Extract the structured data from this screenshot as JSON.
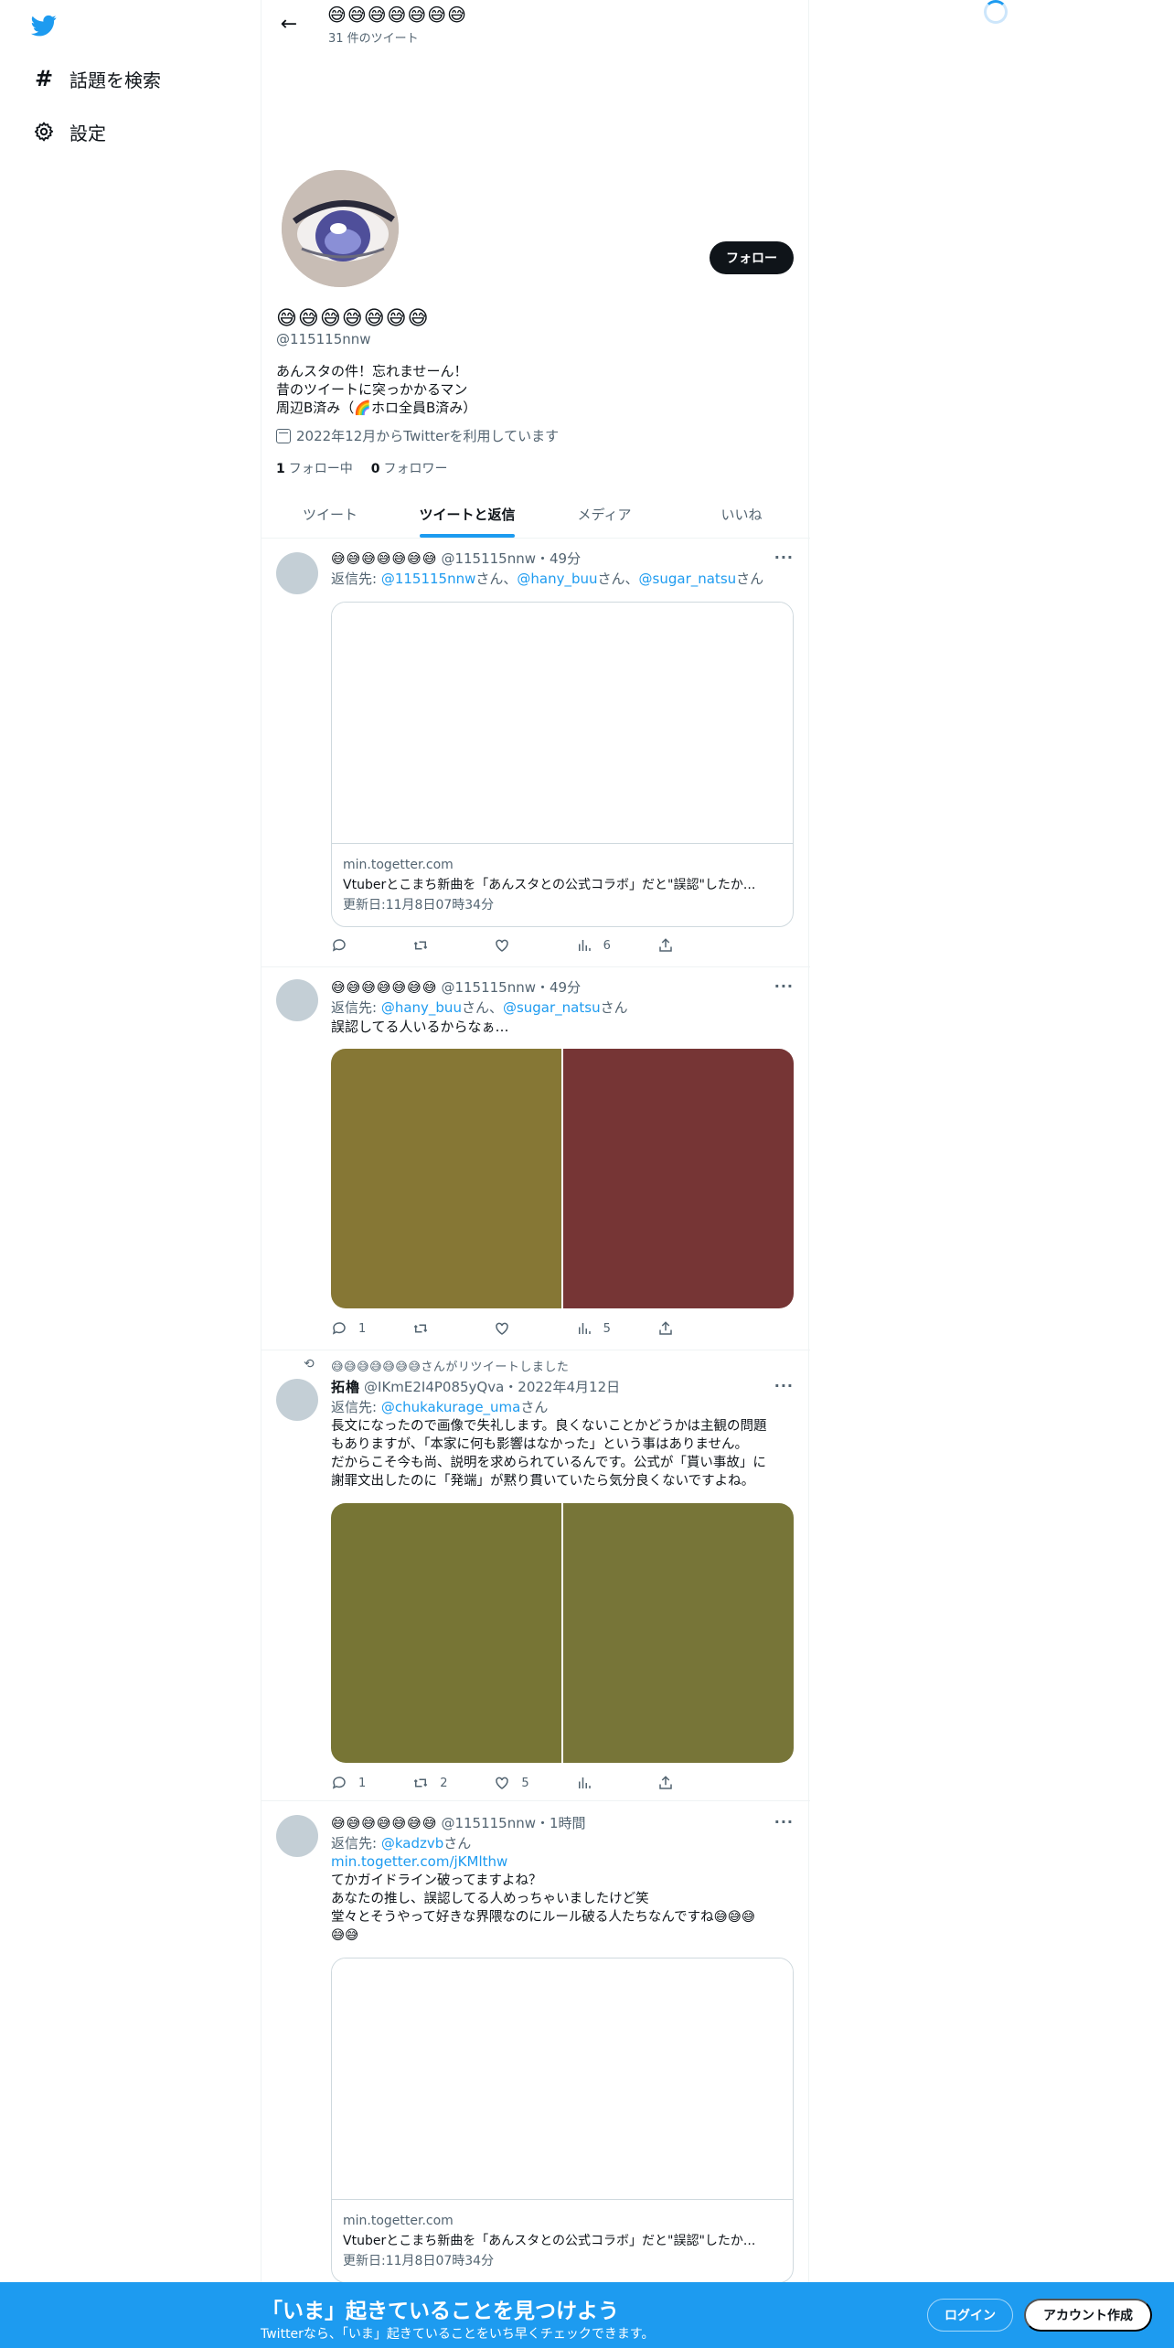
{
  "nav": {
    "items": [
      {
        "icon": "hashtag-icon",
        "label": "話題を検索"
      },
      {
        "icon": "gear-icon",
        "label": "設定"
      }
    ]
  },
  "header": {
    "name": "😅😅😅😅😅😅😅",
    "tweet_count": "31 件のツイート"
  },
  "profile": {
    "name": "😅😅😅😅😅😅😅",
    "handle": "@115115nnw",
    "follow_label": "フォロー",
    "bio": [
      "あんスタの件！忘れませーん！",
      "昔のツイートに突っかかるマン",
      "周辺B済み（🌈ホロ全員B済み）"
    ],
    "joined": "2022年12月からTwitterを利用しています",
    "following_count": "1",
    "following_label": "フォロー中",
    "followers_count": "0",
    "followers_label": "フォロワー"
  },
  "tabs": [
    {
      "label": "ツイート",
      "active": false
    },
    {
      "label": "ツイートと返信",
      "active": true
    },
    {
      "label": "メディア",
      "active": false
    },
    {
      "label": "いいね",
      "active": false
    }
  ],
  "tweets": [
    {
      "name": "😅😅😅😅😅😅😅",
      "handle_time": "@115115nnw・49分",
      "reply_prefix": "返信先: ",
      "reply_to": [
        {
          "handle": "@115115nnw",
          "suffix": "さん、"
        },
        {
          "handle": "@hany_buu",
          "suffix": "さん、"
        },
        {
          "handle": "@sugar_natsu",
          "suffix": "さん"
        }
      ],
      "card": {
        "domain": "min.togetter.com",
        "title": "Vtuberとこまち新曲を「あんスタとの公式コラボ」だと\"誤認\"したか...",
        "updated": "更新日:11月8日07時34分"
      },
      "stats": {
        "reply": "",
        "retweet": "",
        "like": "",
        "views": "6"
      }
    },
    {
      "name": "😅😅😅😅😅😅😅",
      "handle_time": "@115115nnw・49分",
      "reply_prefix": "返信先: ",
      "reply_to": [
        {
          "handle": "@hany_buu",
          "suffix": "さん、"
        },
        {
          "handle": "@sugar_natsu",
          "suffix": "さん"
        }
      ],
      "text": "誤認してる人いるからなぁ…",
      "media_colors": [
        "#867735",
        "#763535"
      ],
      "stats": {
        "reply": "1",
        "retweet": "",
        "like": "",
        "views": "5"
      }
    },
    {
      "retweeted_by": "😅😅😅😅😅😅😅さんがリツイートしました",
      "name": "拓櫓",
      "handle_time": "@IKmE2I4P085yQva・2022年4月12日",
      "reply_prefix": "返信先: ",
      "reply_to": [
        {
          "handle": "@chukakurage_uma",
          "suffix": "さん"
        }
      ],
      "text_lines": [
        "長文になったので画像で失礼します。良くないことかどうかは主観の問題",
        "もありますが、「本家に何も影響はなかった」という事はありません。",
        "だからこそ今も尚、説明を求められているんです。公式が「貰い事故」に",
        "謝罪文出したのに「発端」が黙り貫いていたら気分良くないですよね。"
      ],
      "media_colors": [
        "#777535",
        "#777538"
      ],
      "stats": {
        "reply": "1",
        "retweet": "2",
        "like": "5",
        "views": ""
      }
    },
    {
      "name": "😅😅😅😅😅😅😅",
      "handle_time": "@115115nnw・1時間",
      "reply_prefix": "返信先: ",
      "reply_to": [
        {
          "handle": "@kadzvb",
          "suffix": "さん"
        }
      ],
      "link": "min.togetter.com/jKMlthw",
      "text_lines": [
        "てかガイドライン破ってますよね？",
        "あなたの推し、誤認してる人めっちゃいましたけど笑",
        "堂々とそうやって好きな界隈なのにルール破る人たちなんですね😅😅😅",
        "😅😅"
      ],
      "card": {
        "domain": "min.togetter.com",
        "title": "Vtuberとこまち新曲を「あんスタとの公式コラボ」だと\"誤認\"したか...",
        "updated": "更新日:11月8日07時34分"
      }
    }
  ],
  "bottom_bar": {
    "title": "「いま」起きていることを見つけよう",
    "subtitle": "Twitterなら、「いま」起きていることをいち早くチェックできます。",
    "login": "ログイン",
    "signup": "アカウント作成"
  },
  "colors": {
    "accent": "#1d9bf0",
    "text": "#0f1419",
    "secondary": "#536471"
  }
}
